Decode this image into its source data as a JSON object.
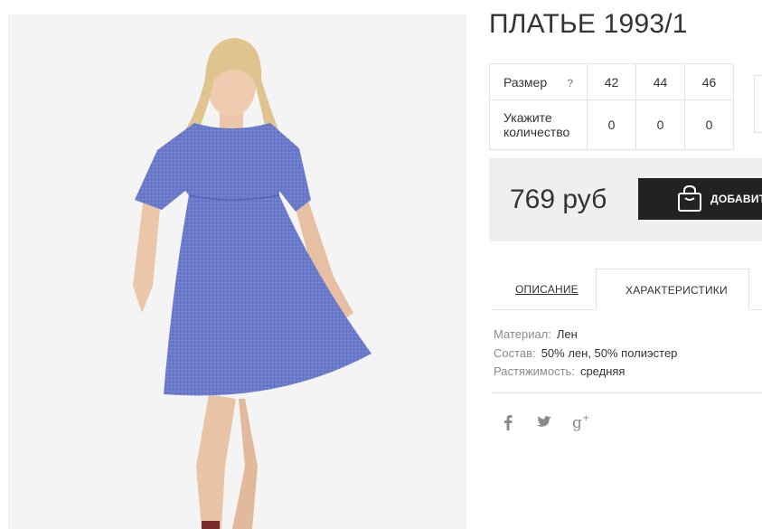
{
  "product": {
    "title": "ПЛАТЬЕ 1993/1",
    "price": "769 руб",
    "add_to_cart_label": "ДОБАВИТ"
  },
  "sizes": {
    "size_label": "Размер",
    "help_label": "?",
    "qty_label": "Укажите количество",
    "options": [
      {
        "size": "42",
        "qty": "0"
      },
      {
        "size": "44",
        "qty": "0"
      },
      {
        "size": "46",
        "qty": "0"
      }
    ]
  },
  "tabs": {
    "description": "ОПИСАНИЕ",
    "characteristics": "ХАРАКТЕРИСТИКИ"
  },
  "specs": [
    {
      "key": "Материал:",
      "value": "Лен"
    },
    {
      "key": "Состав:",
      "value": "50% лен, 50% полиэстер"
    },
    {
      "key": "Растяжимость:",
      "value": "средняя"
    }
  ],
  "social": [
    "facebook-icon",
    "twitter-icon",
    "google-plus-icon"
  ],
  "colors": {
    "button": "#222222",
    "panel": "#efefef",
    "dress": "#6a78c9"
  }
}
